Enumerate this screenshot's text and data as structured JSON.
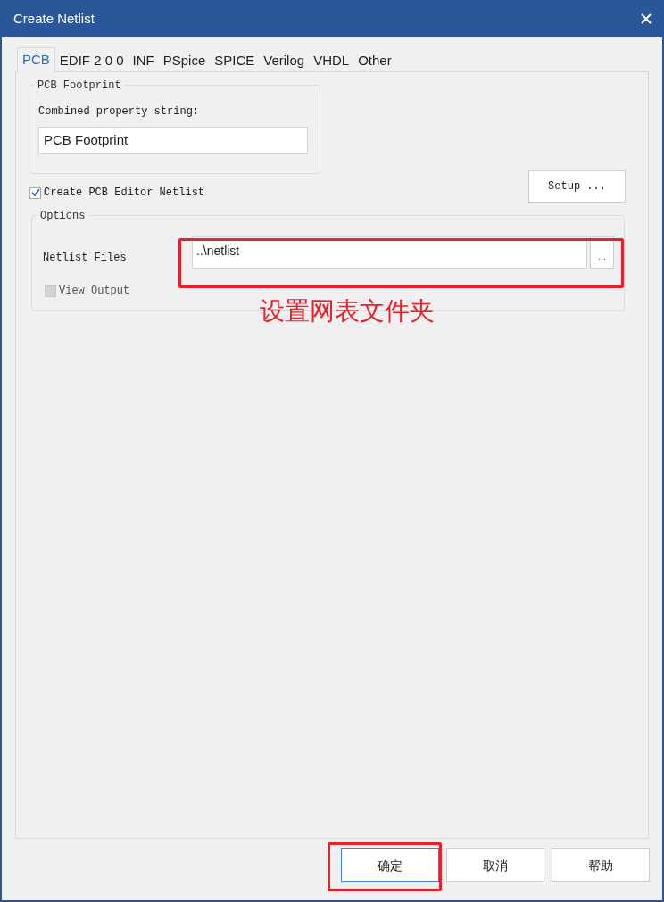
{
  "window": {
    "title": "Create Netlist"
  },
  "tabs": [
    {
      "label": "PCB",
      "selected": true
    },
    {
      "label": "EDIF 2 0 0",
      "selected": false
    },
    {
      "label": "INF",
      "selected": false
    },
    {
      "label": "PSpice",
      "selected": false
    },
    {
      "label": "SPICE",
      "selected": false
    },
    {
      "label": "Verilog",
      "selected": false
    },
    {
      "label": "VHDL",
      "selected": false
    },
    {
      "label": "Other",
      "selected": false
    }
  ],
  "pcb_footprint": {
    "title": "PCB Footprint",
    "label": "Combined property string:",
    "value": "PCB Footprint"
  },
  "create_netlist": {
    "label": "Create PCB Editor Netlist",
    "checked": true
  },
  "setup_button": "Setup ...",
  "options": {
    "title": "Options",
    "directory_label": "Netlist Files",
    "directory_value": "..\\netlist",
    "browse_button": "...",
    "view_output": {
      "label": "View Output",
      "checked": false,
      "disabled": true
    }
  },
  "annotation": {
    "text": "设置网表文件夹"
  },
  "buttons": [
    {
      "label": "确定",
      "focused": true
    },
    {
      "label": "取消",
      "focused": false
    },
    {
      "label": "帮助",
      "focused": false
    }
  ]
}
